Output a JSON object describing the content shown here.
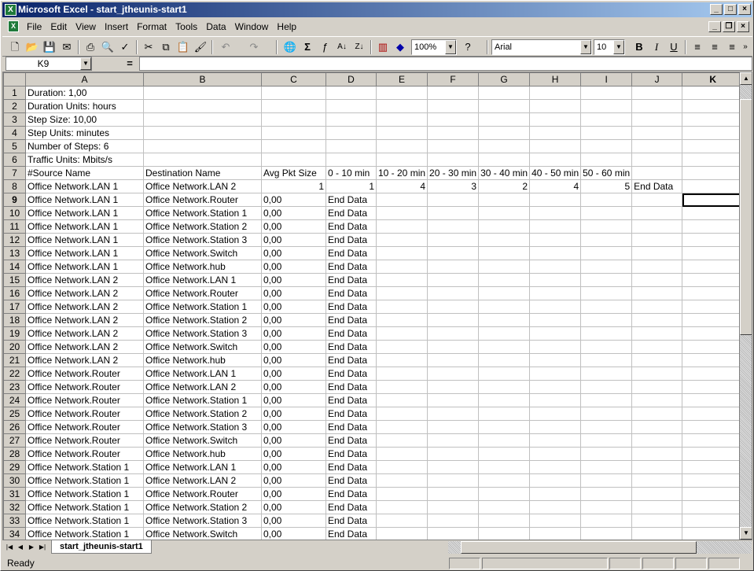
{
  "window": {
    "title": "Microsoft Excel - start_jtheunis-start1",
    "app_icon": "X"
  },
  "menu": [
    "File",
    "Edit",
    "View",
    "Insert",
    "Format",
    "Tools",
    "Data",
    "Window",
    "Help"
  ],
  "toolbar": {
    "zoom": "100%",
    "font": "Arial",
    "font_size": "10",
    "bold": "B",
    "italic": "I",
    "underline": "U"
  },
  "formula_bar": {
    "name_box": "K9",
    "eq": "=",
    "value": ""
  },
  "columns": [
    "A",
    "B",
    "C",
    "D",
    "E",
    "F",
    "G",
    "H",
    "I",
    "J",
    "K"
  ],
  "active_cell": "K9",
  "rows": [
    {
      "n": "1",
      "cells": [
        "Duration: 1,00",
        "",
        "",
        "",
        "",
        "",
        "",
        "",
        "",
        "",
        ""
      ]
    },
    {
      "n": "2",
      "cells": [
        "Duration Units: hours",
        "",
        "",
        "",
        "",
        "",
        "",
        "",
        "",
        "",
        ""
      ]
    },
    {
      "n": "3",
      "cells": [
        "Step Size: 10,00",
        "",
        "",
        "",
        "",
        "",
        "",
        "",
        "",
        "",
        ""
      ]
    },
    {
      "n": "4",
      "cells": [
        "Step Units: minutes",
        "",
        "",
        "",
        "",
        "",
        "",
        "",
        "",
        "",
        ""
      ]
    },
    {
      "n": "5",
      "cells": [
        "Number of Steps: 6",
        "",
        "",
        "",
        "",
        "",
        "",
        "",
        "",
        "",
        ""
      ]
    },
    {
      "n": "6",
      "cells": [
        "Traffic Units: Mbits/s",
        "",
        "",
        "",
        "",
        "",
        "",
        "",
        "",
        "",
        ""
      ]
    },
    {
      "n": "7",
      "cells": [
        "#Source Name",
        "Destination Name",
        "Avg Pkt Size",
        "0 - 10 min",
        "10 - 20 min",
        "20 - 30 min",
        "30 - 40 min",
        "40 - 50 min",
        "50 - 60 min",
        "",
        ""
      ]
    },
    {
      "n": "8",
      "cells": [
        "Office Network.LAN 1",
        "Office Network.LAN 2",
        "1",
        "1",
        "4",
        "3",
        "2",
        "4",
        "5",
        "End Data",
        ""
      ]
    },
    {
      "n": "9",
      "cells": [
        "Office Network.LAN 1",
        "Office Network.Router",
        "0,00",
        "End Data",
        "",
        "",
        "",
        "",
        "",
        "",
        ""
      ]
    },
    {
      "n": "10",
      "cells": [
        "Office Network.LAN 1",
        "Office Network.Station 1",
        "0,00",
        "End Data",
        "",
        "",
        "",
        "",
        "",
        "",
        ""
      ]
    },
    {
      "n": "11",
      "cells": [
        "Office Network.LAN 1",
        "Office Network.Station 2",
        "0,00",
        "End Data",
        "",
        "",
        "",
        "",
        "",
        "",
        ""
      ]
    },
    {
      "n": "12",
      "cells": [
        "Office Network.LAN 1",
        "Office Network.Station 3",
        "0,00",
        "End Data",
        "",
        "",
        "",
        "",
        "",
        "",
        ""
      ]
    },
    {
      "n": "13",
      "cells": [
        "Office Network.LAN 1",
        "Office Network.Switch",
        "0,00",
        "End Data",
        "",
        "",
        "",
        "",
        "",
        "",
        ""
      ]
    },
    {
      "n": "14",
      "cells": [
        "Office Network.LAN 1",
        "Office Network.hub",
        "0,00",
        "End Data",
        "",
        "",
        "",
        "",
        "",
        "",
        ""
      ]
    },
    {
      "n": "15",
      "cells": [
        "Office Network.LAN 2",
        "Office Network.LAN 1",
        "0,00",
        "End Data",
        "",
        "",
        "",
        "",
        "",
        "",
        ""
      ]
    },
    {
      "n": "16",
      "cells": [
        "Office Network.LAN 2",
        "Office Network.Router",
        "0,00",
        "End Data",
        "",
        "",
        "",
        "",
        "",
        "",
        ""
      ]
    },
    {
      "n": "17",
      "cells": [
        "Office Network.LAN 2",
        "Office Network.Station 1",
        "0,00",
        "End Data",
        "",
        "",
        "",
        "",
        "",
        "",
        ""
      ]
    },
    {
      "n": "18",
      "cells": [
        "Office Network.LAN 2",
        "Office Network.Station 2",
        "0,00",
        "End Data",
        "",
        "",
        "",
        "",
        "",
        "",
        ""
      ]
    },
    {
      "n": "19",
      "cells": [
        "Office Network.LAN 2",
        "Office Network.Station 3",
        "0,00",
        "End Data",
        "",
        "",
        "",
        "",
        "",
        "",
        ""
      ]
    },
    {
      "n": "20",
      "cells": [
        "Office Network.LAN 2",
        "Office Network.Switch",
        "0,00",
        "End Data",
        "",
        "",
        "",
        "",
        "",
        "",
        ""
      ]
    },
    {
      "n": "21",
      "cells": [
        "Office Network.LAN 2",
        "Office Network.hub",
        "0,00",
        "End Data",
        "",
        "",
        "",
        "",
        "",
        "",
        ""
      ]
    },
    {
      "n": "22",
      "cells": [
        "Office Network.Router",
        "Office Network.LAN 1",
        "0,00",
        "End Data",
        "",
        "",
        "",
        "",
        "",
        "",
        ""
      ]
    },
    {
      "n": "23",
      "cells": [
        "Office Network.Router",
        "Office Network.LAN 2",
        "0,00",
        "End Data",
        "",
        "",
        "",
        "",
        "",
        "",
        ""
      ]
    },
    {
      "n": "24",
      "cells": [
        "Office Network.Router",
        "Office Network.Station 1",
        "0,00",
        "End Data",
        "",
        "",
        "",
        "",
        "",
        "",
        ""
      ]
    },
    {
      "n": "25",
      "cells": [
        "Office Network.Router",
        "Office Network.Station 2",
        "0,00",
        "End Data",
        "",
        "",
        "",
        "",
        "",
        "",
        ""
      ]
    },
    {
      "n": "26",
      "cells": [
        "Office Network.Router",
        "Office Network.Station 3",
        "0,00",
        "End Data",
        "",
        "",
        "",
        "",
        "",
        "",
        ""
      ]
    },
    {
      "n": "27",
      "cells": [
        "Office Network.Router",
        "Office Network.Switch",
        "0,00",
        "End Data",
        "",
        "",
        "",
        "",
        "",
        "",
        ""
      ]
    },
    {
      "n": "28",
      "cells": [
        "Office Network.Router",
        "Office Network.hub",
        "0,00",
        "End Data",
        "",
        "",
        "",
        "",
        "",
        "",
        ""
      ]
    },
    {
      "n": "29",
      "cells": [
        "Office Network.Station 1",
        "Office Network.LAN 1",
        "0,00",
        "End Data",
        "",
        "",
        "",
        "",
        "",
        "",
        ""
      ]
    },
    {
      "n": "30",
      "cells": [
        "Office Network.Station 1",
        "Office Network.LAN 2",
        "0,00",
        "End Data",
        "",
        "",
        "",
        "",
        "",
        "",
        ""
      ]
    },
    {
      "n": "31",
      "cells": [
        "Office Network.Station 1",
        "Office Network.Router",
        "0,00",
        "End Data",
        "",
        "",
        "",
        "",
        "",
        "",
        ""
      ]
    },
    {
      "n": "32",
      "cells": [
        "Office Network.Station 1",
        "Office Network.Station 2",
        "0,00",
        "End Data",
        "",
        "",
        "",
        "",
        "",
        "",
        ""
      ]
    },
    {
      "n": "33",
      "cells": [
        "Office Network.Station 1",
        "Office Network.Station 3",
        "0,00",
        "End Data",
        "",
        "",
        "",
        "",
        "",
        "",
        ""
      ]
    },
    {
      "n": "34",
      "cells": [
        "Office Network.Station 1",
        "Office Network.Switch",
        "0,00",
        "End Data",
        "",
        "",
        "",
        "",
        "",
        "",
        ""
      ]
    }
  ],
  "sheet_tab": "start_jtheunis-start1",
  "status": "Ready"
}
